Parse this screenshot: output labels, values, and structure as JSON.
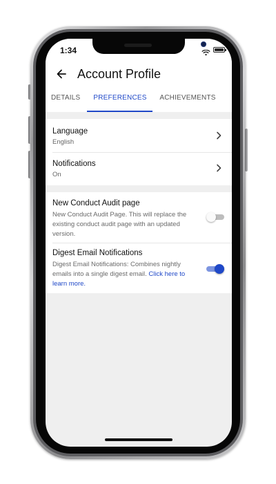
{
  "status_bar": {
    "time": "1:34",
    "wifi_icon": "wifi-icon",
    "battery_icon": "battery-icon"
  },
  "header": {
    "back_icon": "arrow-left-icon",
    "title": "Account Profile"
  },
  "tabs": [
    {
      "label": "DETAILS",
      "active": false
    },
    {
      "label": "PREFERENCES",
      "active": true
    },
    {
      "label": "ACHIEVEMENTS",
      "active": false
    }
  ],
  "settings": {
    "language": {
      "title": "Language",
      "value": "English",
      "icon": "chevron-right-icon"
    },
    "notifications": {
      "title": "Notifications",
      "value": "On",
      "icon": "chevron-right-icon"
    }
  },
  "features": {
    "conduct_audit": {
      "title": "New Conduct Audit page",
      "description": "New Conduct Audit Page. This will replace the existing conduct audit page with an updated version.",
      "enabled": false
    },
    "digest_email": {
      "title": "Digest Email Notifications",
      "description": "Digest Email Notifications: Combines nightly emails into a single digest email.",
      "link_text": "Click here to learn more.",
      "enabled": true
    }
  },
  "colors": {
    "accent": "#1f48c8",
    "background": "#efefef",
    "surface": "#ffffff"
  }
}
